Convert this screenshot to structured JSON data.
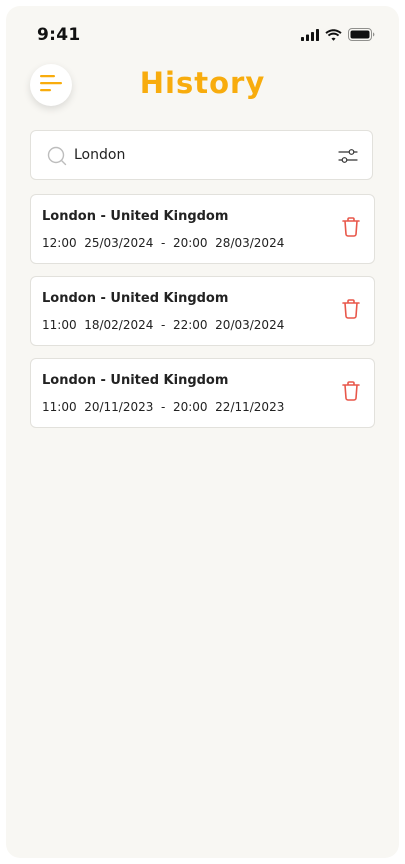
{
  "status_bar": {
    "time": "9:41",
    "icons": [
      "signal-icon",
      "wifi-icon",
      "battery-icon"
    ]
  },
  "header": {
    "menu_icon": "menu-icon",
    "title": "History"
  },
  "search": {
    "value": "London",
    "icon": "search-icon",
    "filter_icon": "filter-icon"
  },
  "history": [
    {
      "location": "London - United Kingdom",
      "times": "12:00  25/03/2024  -  20:00  28/03/2024"
    },
    {
      "location": "London - United Kingdom",
      "times": "11:00  18/02/2024  -  22:00  20/03/2024"
    },
    {
      "location": "London - United Kingdom",
      "times": "11:00  20/11/2023  -  20:00  22/11/2023"
    }
  ],
  "colors": {
    "accent": "#f8ac0d",
    "delete": "#e8574a",
    "background": "#f8f7f3"
  }
}
